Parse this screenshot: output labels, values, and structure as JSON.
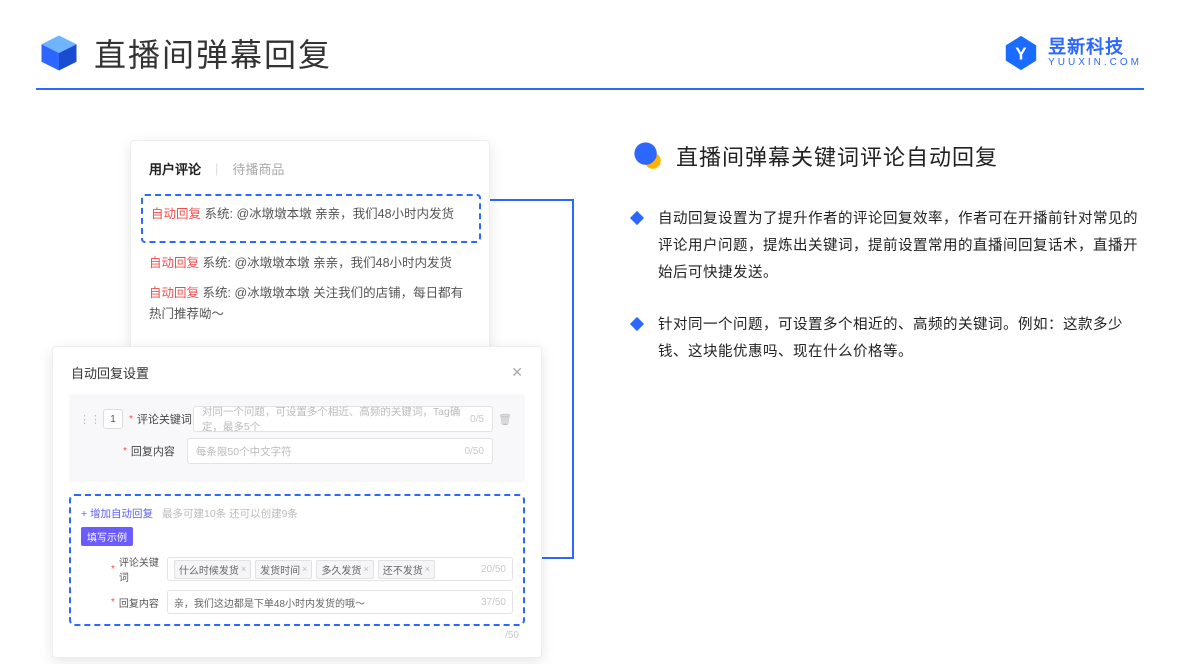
{
  "header": {
    "title": "直播间弹幕回复",
    "brand_name": "昱新科技",
    "brand_sub": "YUUXIN.COM"
  },
  "comments": {
    "tab_active": "用户评论",
    "tab_inactive": "待播商品",
    "tag_label": "自动回复",
    "sys_label": "系统:",
    "line1": "@冰墩墩本墩 亲亲，我们48小时内发货",
    "line2": "@冰墩墩本墩 亲亲，我们48小时内发货",
    "line3": "@冰墩墩本墩 关注我们的店铺，每日都有热门推荐呦～"
  },
  "settings": {
    "title": "自动回复设置",
    "idx": "1",
    "kw_label": "评论关键词",
    "kw_placeholder": "对同一个问题，可设置多个相近、高频的关键词，Tag确定，最多5个",
    "kw_count": "0/5",
    "reply_label": "回复内容",
    "reply_placeholder": "每条限50个中文字符",
    "reply_count": "0/50",
    "add_link": "+ 增加自动回复",
    "add_hint": "最多可建10条 还可以创建9条",
    "badge": "填写示例",
    "sample_kw_label": "评论关键词",
    "sample_tags": [
      "什么时候发货",
      "发货时间",
      "多久发货",
      "还不发货"
    ],
    "sample_kw_count": "20/50",
    "sample_reply_label": "回复内容",
    "sample_reply_value": "亲，我们这边都是下单48小时内发货的哦～",
    "sample_reply_count": "37/50",
    "outer_count": "/50"
  },
  "right": {
    "sec_title": "直播间弹幕关键词评论自动回复",
    "b1": "自动回复设置为了提升作者的评论回复效率，作者可在开播前针对常见的评论用户问题，提炼出关键词，提前设置常用的直播间回复话术，直播开始后可快捷发送。",
    "b2": "针对同一个问题，可设置多个相近的、高频的关键词。例如：这款多少钱、这块能优惠吗、现在什么价格等。"
  }
}
